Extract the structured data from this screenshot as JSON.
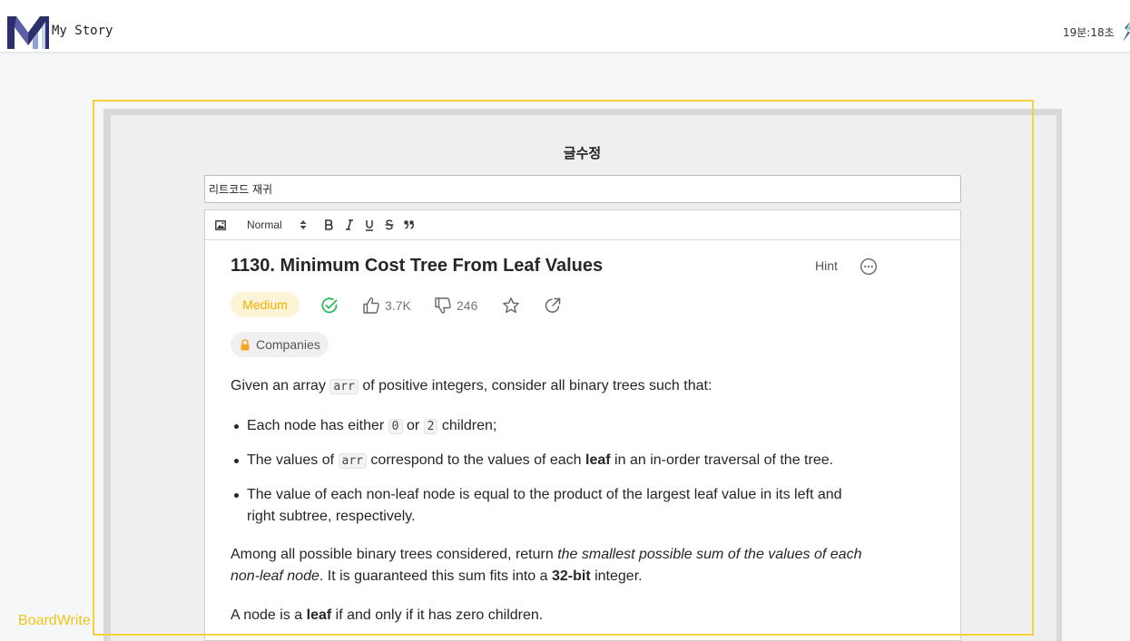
{
  "header": {
    "brand": "My Story",
    "timer": "19분:18초"
  },
  "form": {
    "title": "글수정",
    "title_value": "리트코드 재귀"
  },
  "toolbar": {
    "format_select": "Normal"
  },
  "problem": {
    "title": "1130. Minimum Cost Tree From Leaf Values",
    "hint_label": "Hint",
    "difficulty": "Medium",
    "likes": "3.7K",
    "dislikes": "246",
    "companies_label": "Companies",
    "intro_before": "Given an array ",
    "intro_code": "arr",
    "intro_after": " of positive integers, consider all binary trees such that:",
    "bullet1_before": "Each node has either ",
    "bullet1_code1": "0",
    "bullet1_mid": " or ",
    "bullet1_code2": "2",
    "bullet1_after": " children;",
    "bullet2_before": "The values of ",
    "bullet2_code": "arr",
    "bullet2_mid": " correspond to the values of each ",
    "bullet2_bold": "leaf",
    "bullet2_after": " in an in-order traversal of the tree.",
    "bullet3": "The value of each non-leaf node is equal to the product of the largest leaf value in its left and right subtree, respectively.",
    "para2_before": "Among all possible binary trees considered, return ",
    "para2_italic": "the smallest possible sum of the values of each non-leaf node",
    "para2_mid": ". It is guaranteed this sum fits into a ",
    "para2_bold": "32-bit",
    "para2_after": " integer.",
    "para3_before": "A node is a ",
    "para3_bold": "leaf",
    "para3_after": " if and only if it has zero children."
  },
  "side_label": "BoardWrite",
  "colors": {
    "accent_outline": "#f7d13a",
    "medium_text": "#f0b400",
    "medium_bg": "#fdf3d6",
    "solved_green": "#2cbb5d",
    "lock_orange": "#f5a623"
  }
}
